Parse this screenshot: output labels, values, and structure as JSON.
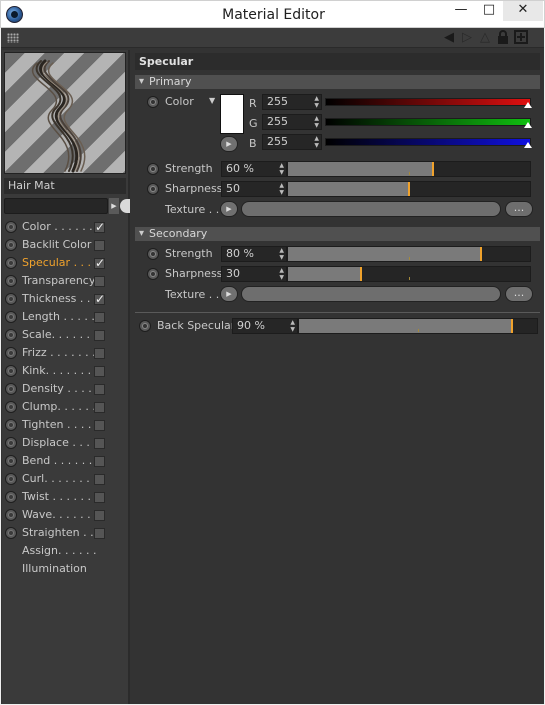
{
  "window": {
    "title": "Material Editor",
    "minimize": "—",
    "maximize": "□",
    "close": "✕"
  },
  "material": {
    "name": "Hair Mat"
  },
  "channels": [
    {
      "label": "Color . . . . . .",
      "checked": true,
      "active": false,
      "radio": true
    },
    {
      "label": "Backlit Color",
      "checked": false,
      "active": false,
      "radio": true
    },
    {
      "label": "Specular . . . .",
      "checked": true,
      "active": true,
      "radio": true
    },
    {
      "label": "Transparency",
      "checked": false,
      "active": false,
      "radio": true
    },
    {
      "label": "Thickness . . .",
      "checked": true,
      "active": false,
      "radio": true
    },
    {
      "label": "Length . . . . .",
      "checked": false,
      "active": false,
      "radio": true
    },
    {
      "label": "Scale. . . . . . .",
      "checked": false,
      "active": false,
      "radio": true
    },
    {
      "label": "Frizz . . . . . . .",
      "checked": false,
      "active": false,
      "radio": true
    },
    {
      "label": "Kink. . . . . . . .",
      "checked": false,
      "active": false,
      "radio": true
    },
    {
      "label": "Density . . . . .",
      "checked": false,
      "active": false,
      "radio": true
    },
    {
      "label": "Clump. . . . . .",
      "checked": false,
      "active": false,
      "radio": true
    },
    {
      "label": "Tighten . . . . .",
      "checked": false,
      "active": false,
      "radio": true
    },
    {
      "label": "Displace . . . .",
      "checked": false,
      "active": false,
      "radio": true
    },
    {
      "label": "Bend . . . . . . .",
      "checked": false,
      "active": false,
      "radio": true
    },
    {
      "label": "Curl. . . . . . . .",
      "checked": false,
      "active": false,
      "radio": true
    },
    {
      "label": "Twist . . . . . . .",
      "checked": false,
      "active": false,
      "radio": true
    },
    {
      "label": "Wave. . . . . . .",
      "checked": false,
      "active": false,
      "radio": true
    },
    {
      "label": "Straighten . .",
      "checked": false,
      "active": false,
      "radio": true
    },
    {
      "label": "Assign. . . . . .",
      "checked": null,
      "active": false,
      "radio": false
    },
    {
      "label": "Illumination",
      "checked": null,
      "active": false,
      "radio": false
    }
  ],
  "specular": {
    "title": "Specular",
    "primary": {
      "header": "Primary",
      "color_label": "Color",
      "swatch_color": "#ffffff",
      "r_label": "R",
      "r_value": "255",
      "r_level": 1.0,
      "g_label": "G",
      "g_value": "255",
      "g_level": 1.0,
      "b_label": "B",
      "b_value": "255",
      "b_level": 1.0,
      "strength_label": "Strength",
      "strength_value": "60 %",
      "strength_level": 0.6,
      "sharpness_label": "Sharpness",
      "sharpness_value": "50",
      "sharpness_level": 0.5,
      "texture_label": "Texture . .",
      "texture_more": "..."
    },
    "secondary": {
      "header": "Secondary",
      "strength_label": "Strength",
      "strength_value": "80 %",
      "strength_level": 0.8,
      "sharpness_label": "Sharpness",
      "sharpness_value": "30",
      "sharpness_level": 0.3,
      "texture_label": "Texture . .",
      "texture_more": "..."
    },
    "back": {
      "label": "Back Specular",
      "value": "90 %",
      "level": 0.9
    }
  },
  "colors": {
    "accent": "#f0a22c",
    "red": "#e01010",
    "green": "#10c010",
    "blue": "#1010e0"
  }
}
